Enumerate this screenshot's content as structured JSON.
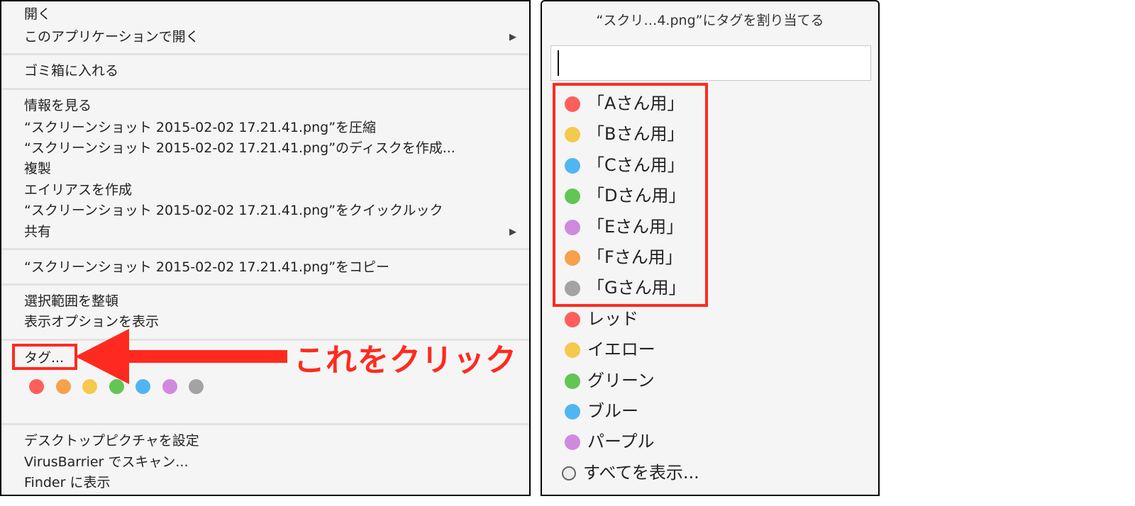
{
  "context_menu": {
    "groups": [
      [
        {
          "label": "開く"
        },
        {
          "label": "このアプリケーションで開く",
          "submenu": true
        }
      ],
      [
        {
          "label": "ゴミ箱に入れる"
        }
      ],
      [
        {
          "label": "情報を見る"
        },
        {
          "label": "“スクリーンショット 2015-02-02 17.21.41.png”を圧縮"
        },
        {
          "label": "“スクリーンショット 2015-02-02 17.21.41.png”のディスクを作成..."
        },
        {
          "label": "複製"
        },
        {
          "label": "エイリアスを作成"
        },
        {
          "label": "“スクリーンショット 2015-02-02 17.21.41.png”をクイックルック"
        },
        {
          "label": "共有",
          "submenu": true
        }
      ],
      [
        {
          "label": "“スクリーンショット 2015-02-02 17.21.41.png”をコピー"
        }
      ],
      [
        {
          "label": "選択範囲を整頓"
        },
        {
          "label": "表示オプションを表示"
        }
      ],
      [
        {
          "label": "タグ..."
        }
      ],
      [
        {
          "label": "デスクトップピクチャを設定"
        },
        {
          "label": "VirusBarrier でスキャン..."
        },
        {
          "label": "Finder に表示"
        }
      ]
    ],
    "tag_colors": [
      "#fe5f5a",
      "#f8a04a",
      "#f5c94e",
      "#62c554",
      "#4fb6f2",
      "#cf8ae0",
      "#a3a3a3"
    ],
    "submenu_arrow": "▶"
  },
  "annotation": {
    "text": "これをクリック",
    "color": "#ff2a1f"
  },
  "tag_dialog": {
    "title": "“スクリ…4.png”にタグを割り当てる",
    "input_value": "",
    "custom_tags": [
      {
        "label": "「Aさん用」",
        "color": "#fe5f5a"
      },
      {
        "label": "「Bさん用」",
        "color": "#f5c94e"
      },
      {
        "label": "「Cさん用」",
        "color": "#4fb6f2"
      },
      {
        "label": "「Dさん用」",
        "color": "#62c554"
      },
      {
        "label": "「Eさん用」",
        "color": "#cf8ae0"
      },
      {
        "label": "「Fさん用」",
        "color": "#f8a04a"
      },
      {
        "label": "「Gさん用」",
        "color": "#a3a3a3"
      }
    ],
    "default_tags": [
      {
        "label": "レッド",
        "color": "#fe5f5a"
      },
      {
        "label": "イエロー",
        "color": "#f5c94e"
      },
      {
        "label": "グリーン",
        "color": "#62c554"
      },
      {
        "label": "ブルー",
        "color": "#4fb6f2"
      },
      {
        "label": "パープル",
        "color": "#cf8ae0"
      }
    ],
    "show_all": "すべてを表示..."
  }
}
